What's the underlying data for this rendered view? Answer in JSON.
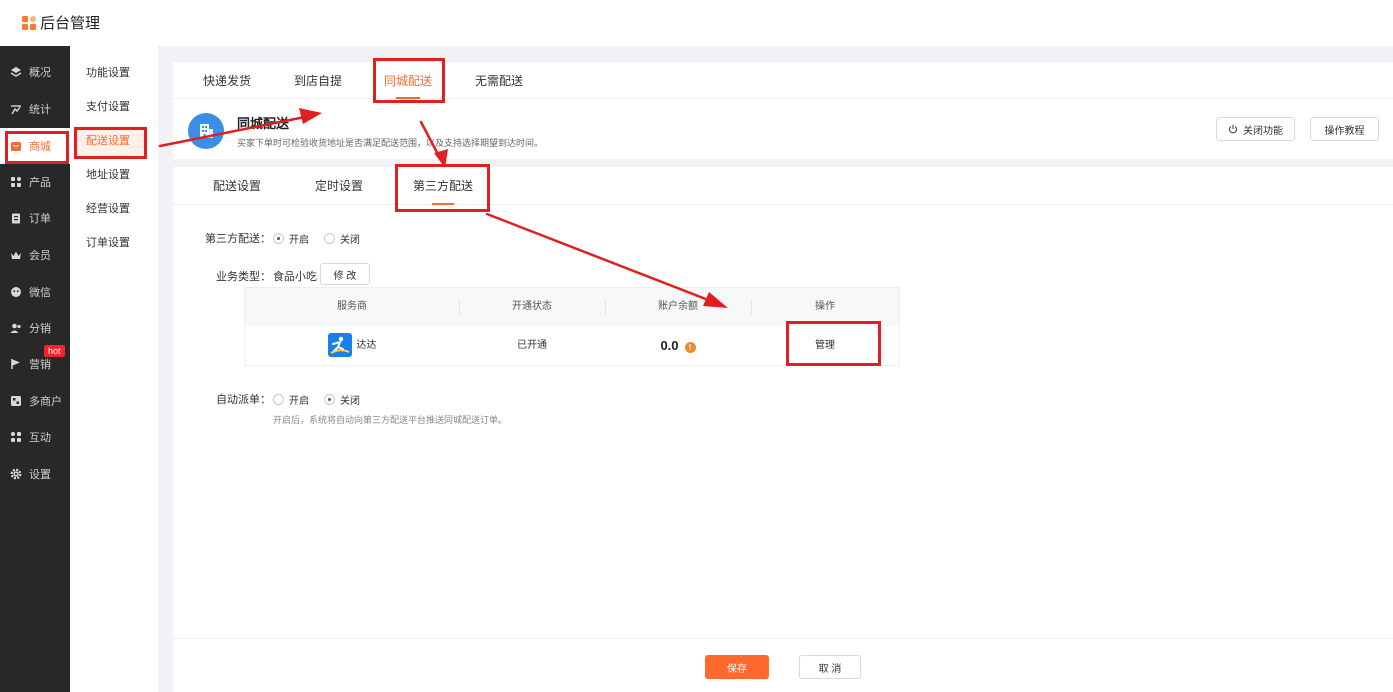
{
  "app": {
    "title": "后台管理"
  },
  "sidebar": {
    "items": [
      {
        "label": "概况",
        "icon": "layers-icon"
      },
      {
        "label": "统计",
        "icon": "chart-icon"
      },
      {
        "label": "商城",
        "icon": "shop-icon"
      },
      {
        "label": "产品",
        "icon": "grid-icon"
      },
      {
        "label": "订单",
        "icon": "clipboard-icon"
      },
      {
        "label": "会员",
        "icon": "crown-icon"
      },
      {
        "label": "微信",
        "icon": "wechat-icon"
      },
      {
        "label": "分销",
        "icon": "users-icon"
      },
      {
        "label": "营销",
        "icon": "flag-icon"
      },
      {
        "label": "多商户",
        "icon": "store-icon"
      },
      {
        "label": "互动",
        "icon": "interact-icon"
      },
      {
        "label": "设置",
        "icon": "gear-icon"
      }
    ],
    "hot_badge": "hot"
  },
  "subnav": {
    "items": [
      "功能设置",
      "支付设置",
      "配送设置",
      "地址设置",
      "经营设置",
      "订单设置"
    ]
  },
  "top_tabs": [
    "快递发货",
    "到店自提",
    "同城配送",
    "无需配送"
  ],
  "feature": {
    "title": "同城配送",
    "description": "买家下单时可检验收货地址是否满足配送范围，以及支持选择期望到达时间。",
    "close_button": "关闭功能",
    "tutorial_button": "操作教程"
  },
  "sub_tabs": [
    "配送设置",
    "定时设置",
    "第三方配送"
  ],
  "form": {
    "third_party_label": "第三方配送：",
    "open": "开启",
    "close": "关闭",
    "business_type_label": "业务类型：",
    "business_type_value": "食品小吃",
    "modify_button": "修 改",
    "auto_dispatch_label": "自动派单：",
    "auto_dispatch_hint": "开启后，系统将自动向第三方配送平台推送同城配送订单。"
  },
  "table": {
    "headers": [
      "服务商",
      "开通状态",
      "账户余额",
      "操作"
    ],
    "rows": [
      {
        "provider": "达达",
        "status": "已开通",
        "balance": "0.0",
        "action": "管理"
      }
    ]
  },
  "footer": {
    "save": "保存",
    "cancel": "取 消"
  }
}
